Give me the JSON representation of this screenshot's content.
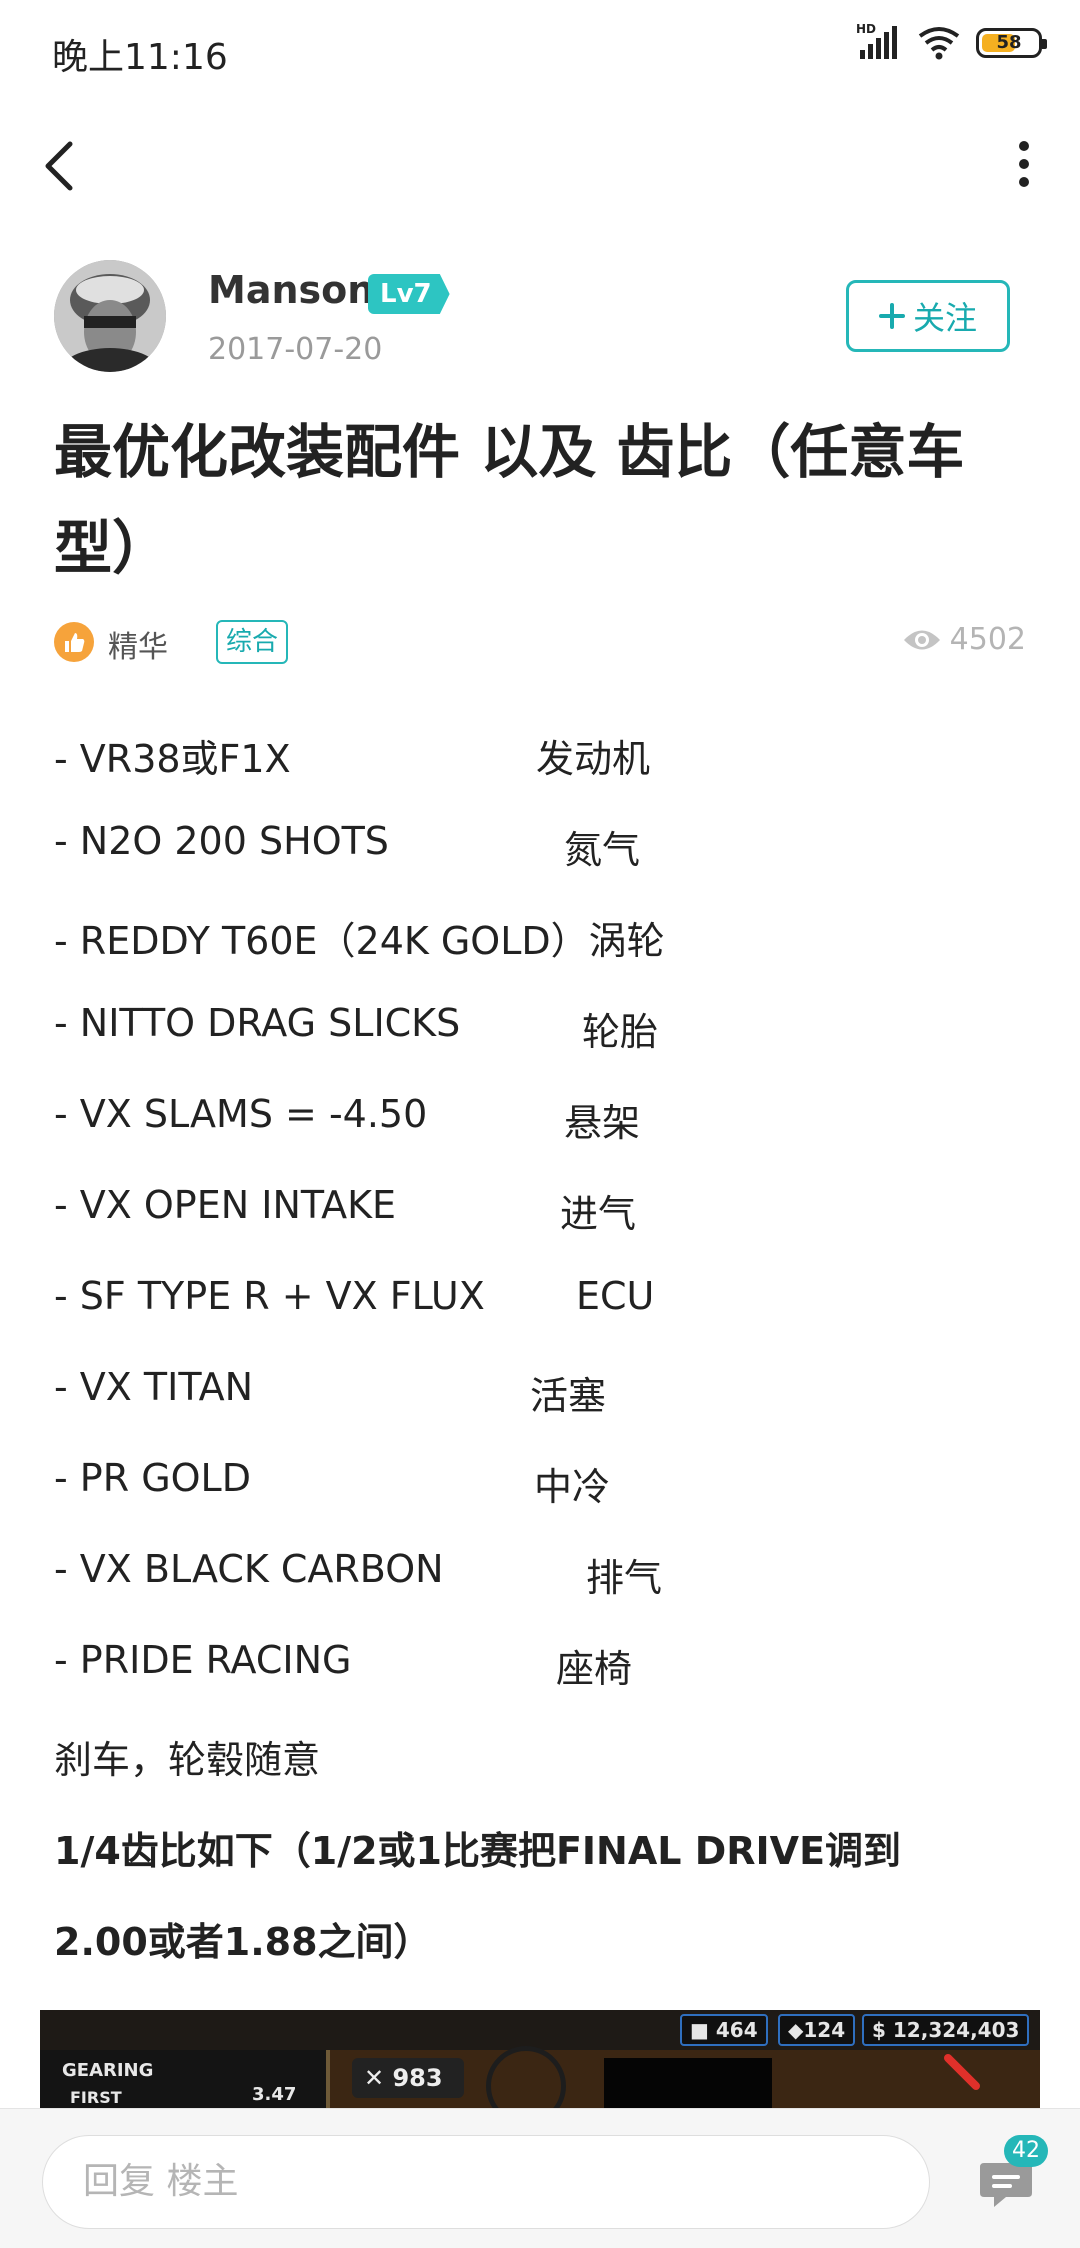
{
  "status_bar": {
    "time": "晚上11:16",
    "network": "HD",
    "battery": "58"
  },
  "author": {
    "name": "Manson",
    "level": "Lv7",
    "date": "2017-07-20",
    "follow_label": "关注",
    "follow_icon": "plus-icon"
  },
  "post": {
    "title": "最优化改装配件 以及 齿比（任意车型）",
    "essence_label": "精华",
    "category": "综合",
    "views": "4502",
    "specs": [
      {
        "part": "- VR38或F1X",
        "cn": "发动机"
      },
      {
        "part": "- N2O 200 SHOTS",
        "cn": "氮气"
      },
      {
        "part": "- REDDY T60E（24K GOLD）涡轮",
        "cn": ""
      },
      {
        "part": "- NITTO DRAG SLICKS",
        "cn": "轮胎"
      },
      {
        "part": "- VX SLAMS = -4.50",
        "cn": "悬架"
      },
      {
        "part": "- VX OPEN INTAKE",
        "cn": "进气"
      },
      {
        "part": "- SF TYPE R + VX FLUX",
        "cn": "ECU"
      },
      {
        "part": "- VX TITAN",
        "cn": "活塞"
      },
      {
        "part": "- PR GOLD",
        "cn": "中冷"
      },
      {
        "part": "- VX BLACK CARBON",
        "cn": "排气"
      },
      {
        "part": "- PRIDE RACING",
        "cn": "座椅"
      }
    ],
    "note": "刹车，轮毂随意",
    "gear_intro_1": "1/4齿比如下（1/2或1比赛把FINAL DRIVE调到",
    "gear_intro_2": "2.00或者1.88之间）"
  },
  "game_image": {
    "res_a": "464",
    "res_b": "124",
    "cash": "12,324,403",
    "gearing_label": "GEARING",
    "first_label": "FIRST",
    "first_value": "3.47",
    "counter": "983"
  },
  "reply_bar": {
    "placeholder": "回复  楼主",
    "comment_count": "42"
  },
  "colors": {
    "accent": "#25b7b8",
    "level_badge": "#2dc5c2",
    "essence": "#f6a33b"
  }
}
